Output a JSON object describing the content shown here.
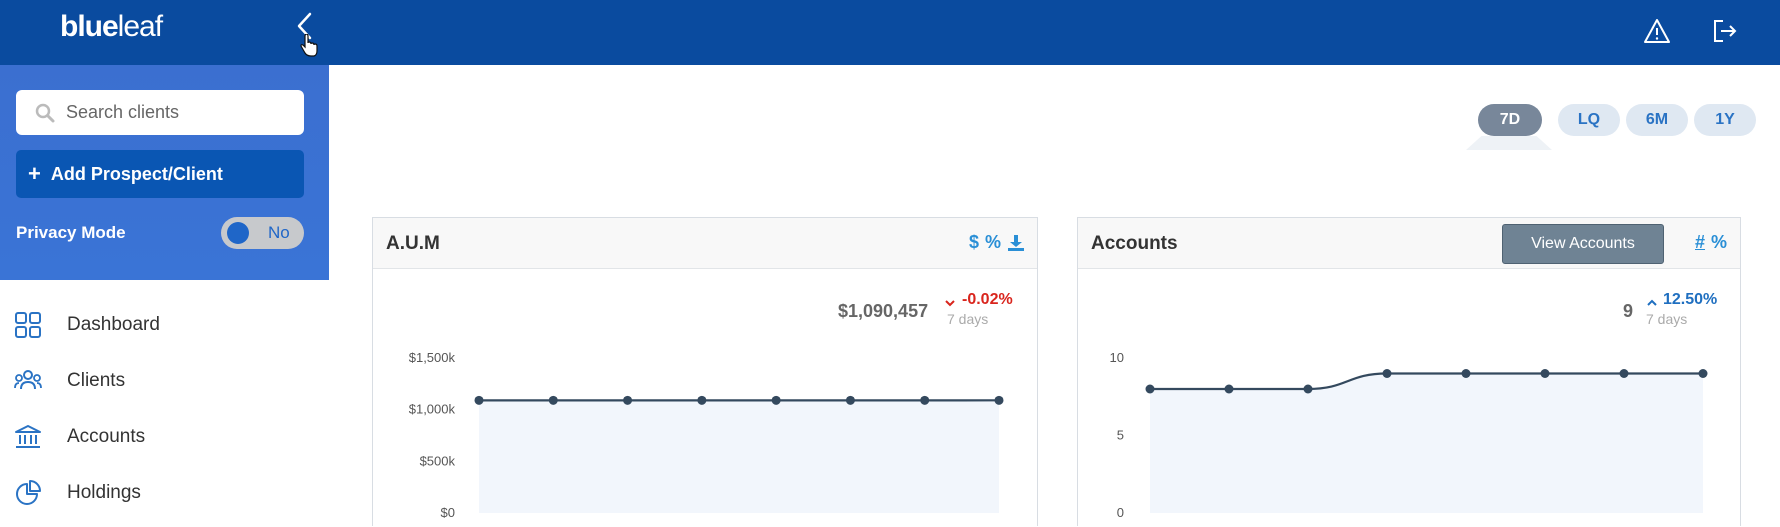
{
  "header": {
    "logo_bold": "blue",
    "logo_light": "leaf",
    "colors": {
      "bar": "#0a4b9f"
    }
  },
  "sidebar": {
    "search_placeholder": "Search clients",
    "add_button": "Add Prospect/Client",
    "privacy_label": "Privacy Mode",
    "privacy_value": "No",
    "nav": [
      {
        "label": "Dashboard",
        "icon": "dashboard-grid-icon"
      },
      {
        "label": "Clients",
        "icon": "people-icon"
      },
      {
        "label": "Accounts",
        "icon": "bank-icon"
      },
      {
        "label": "Holdings",
        "icon": "pie-chart-icon"
      }
    ]
  },
  "ranges": [
    {
      "label": "7D",
      "active": true
    },
    {
      "label": "LQ",
      "active": false
    },
    {
      "label": "6M",
      "active": false
    },
    {
      "label": "1Y",
      "active": false
    }
  ],
  "aum": {
    "title": "A.U.M",
    "icons": [
      "dollar-icon",
      "percent-icon",
      "download-icon"
    ],
    "value": "$1,090,457",
    "delta": "-0.02%",
    "delta_direction": "down",
    "period": "7 days",
    "delta_color": "#d9251d"
  },
  "accounts": {
    "title": "Accounts",
    "view_button": "View Accounts",
    "icons": [
      "hash-icon",
      "percent-icon"
    ],
    "value": "9",
    "delta": "12.50%",
    "delta_direction": "up",
    "period": "7 days",
    "delta_color": "#1f6fc0"
  },
  "chart_data": [
    {
      "type": "area",
      "ylim": [
        0,
        1500000
      ],
      "y_ticks": [
        "$0",
        "$500k",
        "$1,000k",
        "$1,500k"
      ],
      "y_tick_values": [
        0,
        500000,
        1000000,
        1500000
      ],
      "values": [
        1090000,
        1090000,
        1090000,
        1090000,
        1090000,
        1090000,
        1090000,
        1090457
      ],
      "line_color": "#34495e",
      "fill_color": "#f2f6fc"
    },
    {
      "type": "area",
      "ylim": [
        0,
        10
      ],
      "y_ticks": [
        "0",
        "5",
        "10"
      ],
      "y_tick_values": [
        0,
        5,
        10
      ],
      "values": [
        8,
        8,
        8,
        9,
        9,
        9,
        9,
        9
      ],
      "line_color": "#34495e",
      "fill_color": "#f2f6fc"
    }
  ]
}
